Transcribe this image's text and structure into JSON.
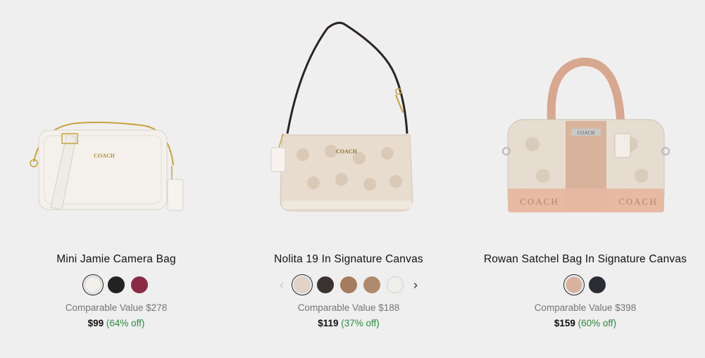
{
  "products": [
    {
      "name": "Mini Jamie Camera Bag",
      "comparable": "Comparable Value $278",
      "price": "$99",
      "discount": "(64% off)",
      "swatches": [
        "#f3efea",
        "#222222",
        "#8a2a44"
      ],
      "selected_swatch": 0,
      "image_icon": "camera-bag-image"
    },
    {
      "name": "Nolita 19 In Signature Canvas",
      "comparable": "Comparable Value $188",
      "price": "$119",
      "discount": "(37% off)",
      "swatches": [
        "#e2d3c6",
        "#3a3330",
        "#a67c5f",
        "#b08a6c",
        "#f1efea"
      ],
      "selected_swatch": 0,
      "prev_arrow": "‹",
      "next_arrow": "›",
      "image_icon": "shoulder-bag-image"
    },
    {
      "name": "Rowan Satchel Bag In Signature Canvas",
      "comparable": "Comparable Value $398",
      "price": "$159",
      "discount": "(60% off)",
      "swatches": [
        "#d9b29b",
        "#2a2d33"
      ],
      "selected_swatch": 0,
      "image_icon": "satchel-bag-image"
    }
  ],
  "brand_text": "COACH"
}
